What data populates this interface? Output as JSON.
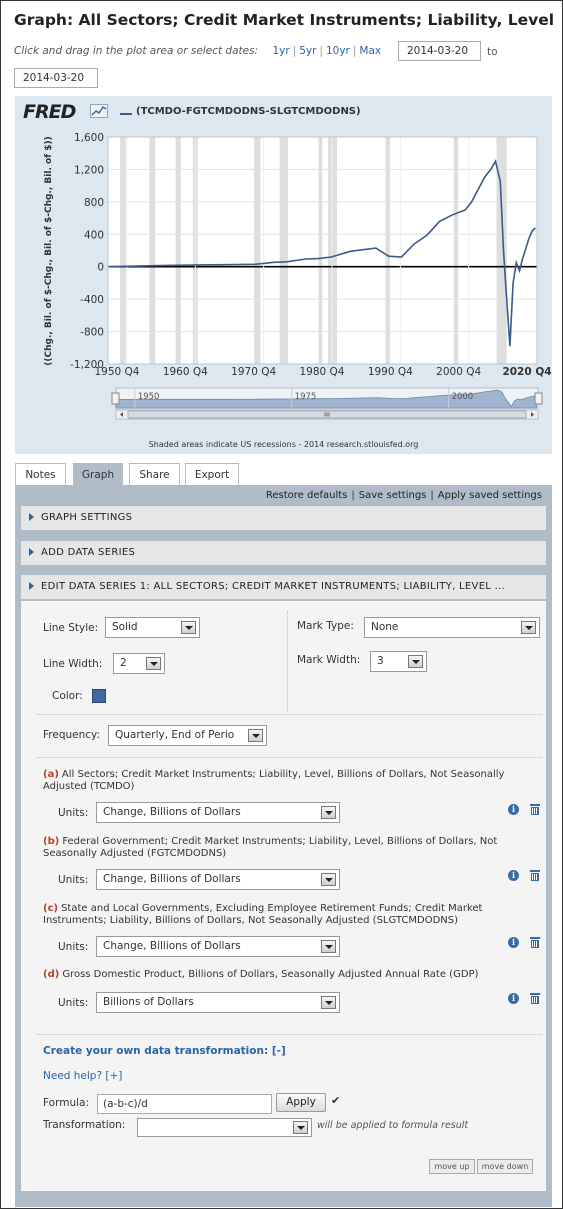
{
  "page": {
    "title": "Graph: All Sectors; Credit Market Instruments; Liability, Level",
    "date_hint": "Click and drag in the plot area or select dates:",
    "ranges": [
      "1yr",
      "5yr",
      "10yr",
      "Max"
    ],
    "start_date": "2014-03-20",
    "to_label": "to",
    "end_date": "2014-03-20"
  },
  "chart": {
    "logo": "FRED",
    "legend": "(TCMDO-FGTCMDODNS-SLGTCMDODNS)",
    "recession_note": "Shaded areas indicate US recessions - 2014 research.stlouisfed.org"
  },
  "chart_data": {
    "type": "line",
    "series": [
      {
        "name": "(TCMDO-FGTCMDODNS-SLGTCMDODNS)",
        "x": [
          1947,
          1950,
          1955,
          1960,
          1965,
          1970,
          1973,
          1975,
          1978,
          1980,
          1982,
          1985,
          1987,
          1989,
          1991,
          1993,
          1995,
          1997,
          1999,
          2001,
          2003,
          2004,
          2005,
          2006,
          2007,
          2007.75,
          2008.5,
          2009,
          2009.5,
          2010,
          2010.5,
          2011,
          2011.5,
          2012,
          2013,
          2013.5,
          2014
        ],
        "values": [
          0,
          5,
          15,
          20,
          25,
          30,
          55,
          60,
          95,
          100,
          120,
          190,
          210,
          230,
          130,
          120,
          280,
          390,
          560,
          640,
          700,
          800,
          950,
          1100,
          1200,
          1300,
          1050,
          200,
          -400,
          -980,
          -200,
          50,
          -50,
          100,
          350,
          440,
          480
        ],
        "color": "#3c5a8a"
      }
    ],
    "ylabel": "((Chg., Bil. of $-Chg., Bil. of $-Chg., Bil. of $))",
    "ylim": [
      -1200,
      1600
    ],
    "yticks": [
      "1,600",
      "1,200",
      "800",
      "400",
      "0",
      "-400",
      "-800",
      "-1,200"
    ],
    "xlim": [
      1947,
      2014.25
    ],
    "xticks": [
      "1950 Q4",
      "1960 Q4",
      "1970 Q4",
      "1980 Q4",
      "1990 Q4",
      "2000 Q4",
      "2020 Q4"
    ],
    "navigator_ticks": [
      "1950",
      "1975",
      "2000"
    ],
    "recessions": [
      [
        1948.9,
        1949.8
      ],
      [
        1953.5,
        1954.4
      ],
      [
        1957.6,
        1958.4
      ],
      [
        1960.3,
        1961.1
      ],
      [
        1969.9,
        1970.9
      ],
      [
        1973.9,
        1975.2
      ],
      [
        1980.0,
        1980.6
      ],
      [
        1981.5,
        1982.9
      ],
      [
        1990.5,
        1991.2
      ],
      [
        2001.2,
        2001.9
      ],
      [
        2007.9,
        2009.5
      ]
    ],
    "zero_line": true,
    "grid": true
  },
  "tabs": [
    "Notes",
    "Graph",
    "Share",
    "Export"
  ],
  "toplinks": [
    "Restore defaults",
    "Save settings",
    "Apply saved settings"
  ],
  "sections": {
    "graph_settings": "GRAPH SETTINGS",
    "add_data": "ADD DATA SERIES",
    "edit_series": "EDIT DATA SERIES 1: ALL SECTORS; CREDIT MARKET INSTRUMENTS; LIABILITY, LEVEL ..."
  },
  "edit": {
    "line_style_label": "Line Style:",
    "line_style": "Solid",
    "line_width_label": "Line Width:",
    "line_width": "2",
    "color_label": "Color:",
    "color": "#3c6aa0",
    "mark_type_label": "Mark Type:",
    "mark_type": "None",
    "mark_width_label": "Mark Width:",
    "mark_width": "3",
    "frequency_label": "Frequency:",
    "frequency": "Quarterly, End of Perio",
    "units_label": "Units:",
    "series": [
      {
        "letter": "(a)",
        "desc": "All Sectors; Credit Market Instruments; Liability, Level, Billions of Dollars, Not Seasonally Adjusted (TCMDO)",
        "units": "Change, Billions of Dollars"
      },
      {
        "letter": "(b)",
        "desc": "Federal Government; Credit Market Instruments; Liability, Level, Billions of Dollars, Not Seasonally Adjusted (FGTCMDODNS)",
        "units": "Change, Billions of Dollars"
      },
      {
        "letter": "(c)",
        "desc": "State and Local Governments, Excluding Employee Retirement Funds; Credit Market Instruments; Liability, Billions of Dollars, Not Seasonally Adjusted (SLGTCMDODNS)",
        "units": "Change, Billions of Dollars"
      },
      {
        "letter": "(d)",
        "desc": "Gross Domestic Product, Billions of Dollars, Seasonally Adjusted Annual Rate (GDP)",
        "units": "Billions of Dollars"
      }
    ],
    "create_transformation": "Create your own data transformation: [-]",
    "need_help": "Need help? [+]",
    "formula_label": "Formula:",
    "formula": "(a-b-c)/d",
    "apply": "Apply",
    "checkmark": "✔",
    "transformation_label": "Transformation:",
    "transformation": "",
    "transformation_hint": "will be applied to formula result",
    "move_up": "move up",
    "move_down": "move down"
  }
}
